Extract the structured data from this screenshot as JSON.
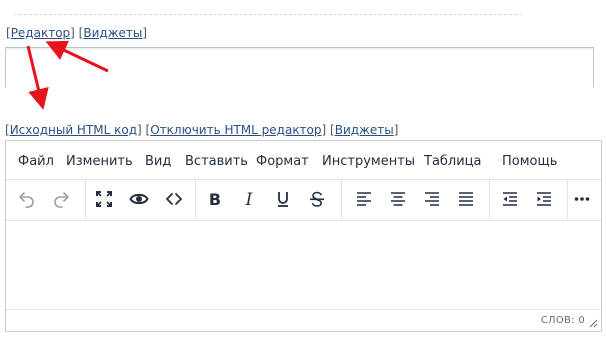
{
  "top_links": {
    "editor": "Редактор",
    "widgets": "Виджеты"
  },
  "bottom_links": {
    "html_source": "Исходный HTML код",
    "disable_html": "Отключить HTML редактор",
    "widgets": "Виджеты"
  },
  "menubar": {
    "file": "Файл",
    "edit": "Изменить",
    "view": "Вид",
    "insert": "Вставить",
    "format": "Формат",
    "tools": "Инструменты",
    "table": "Таблица",
    "help": "Помощь"
  },
  "toolbar_icons": [
    "undo-icon",
    "redo-icon",
    "fullscreen-icon",
    "preview-icon",
    "code-icon",
    "bold-icon",
    "italic-icon",
    "underline-icon",
    "strikethrough-icon",
    "align-left-icon",
    "align-center-icon",
    "align-right-icon",
    "justify-icon",
    "outdent-icon",
    "indent-icon",
    "more-icon"
  ],
  "statusbar": {
    "word_count": "СЛОВ: 0"
  },
  "colors": {
    "annotation_arrow": "#e8141d",
    "link": "#2a4f86",
    "toolbar_icon": "#222f3e"
  }
}
